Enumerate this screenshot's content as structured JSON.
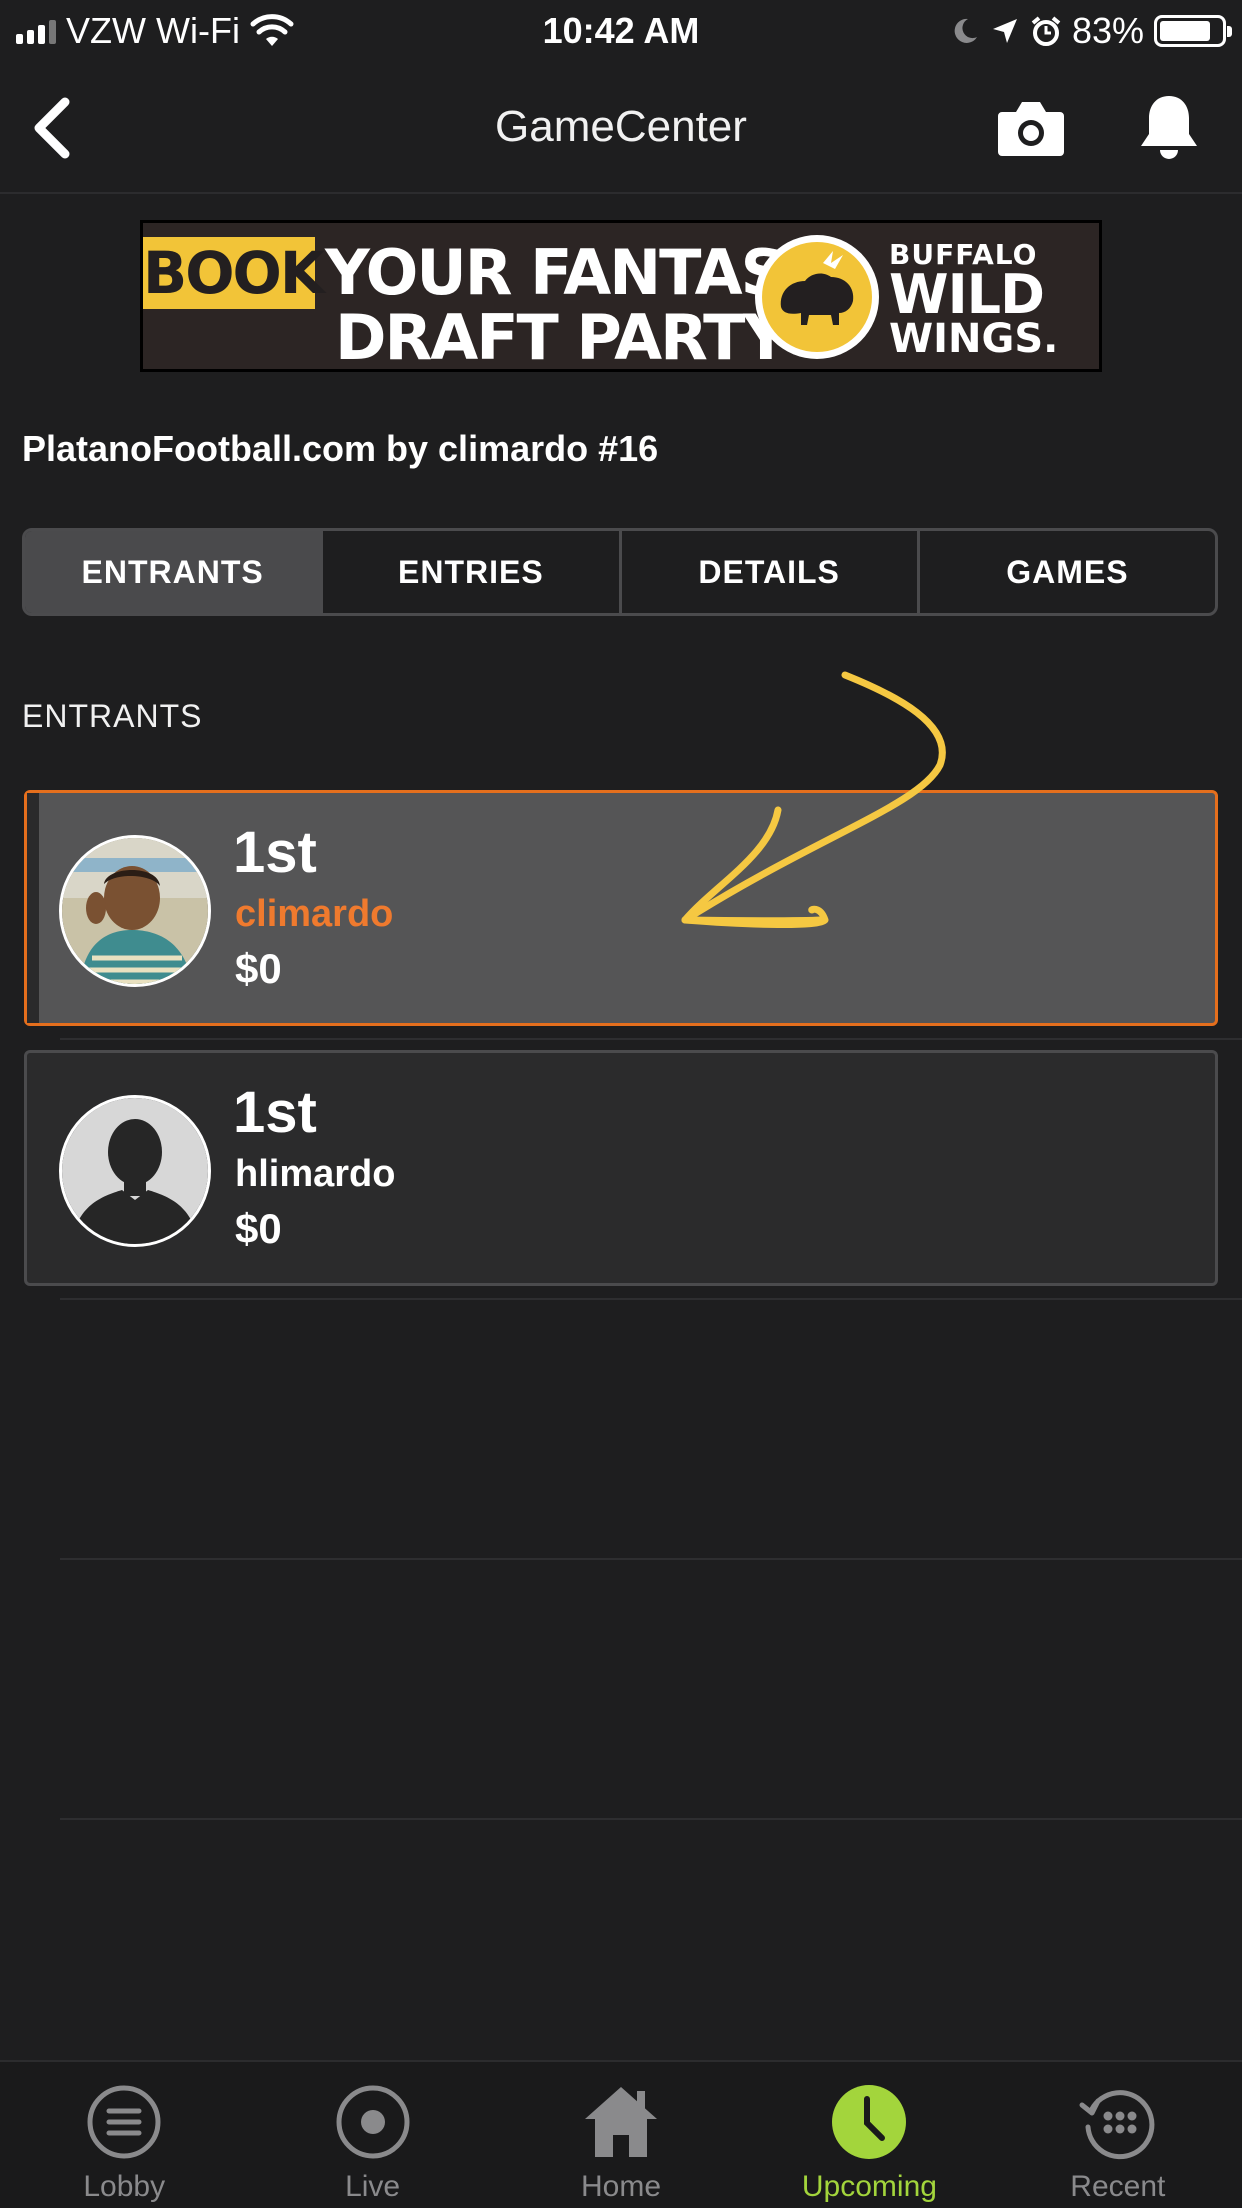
{
  "status_bar": {
    "carrier": "VZW Wi-Fi",
    "time": "10:42 AM",
    "battery": "83%",
    "battery_level": 0.83,
    "icons": [
      "signal-icon",
      "wifi-icon",
      "moon-icon",
      "location-arrow-icon",
      "alarm-icon",
      "battery-icon"
    ]
  },
  "nav": {
    "title": "GameCenter",
    "icons": [
      "back-chevron-icon",
      "camera-icon",
      "bell-icon"
    ]
  },
  "ad": {
    "book": "BOOK",
    "line1": "YOUR FANTASY",
    "line2": "DRAFT PARTY",
    "brand_line1": "BUFFALO",
    "brand_line2": "WILD",
    "brand_line3": "WINGS."
  },
  "league": {
    "title": "PlatanoFootball.com by climardo #16"
  },
  "tabs": [
    {
      "label": "ENTRANTS",
      "active": true
    },
    {
      "label": "ENTRIES",
      "active": false
    },
    {
      "label": "DETAILS",
      "active": false
    },
    {
      "label": "GAMES",
      "active": false
    }
  ],
  "section_header": "ENTRANTS",
  "entrants": [
    {
      "rank": "1st",
      "username": "climardo",
      "amount": "$0",
      "highlighted": true
    },
    {
      "rank": "1st",
      "username": "hlimardo",
      "amount": "$0",
      "highlighted": false
    }
  ],
  "colors": {
    "background": "#1e1e1f",
    "highlight_border": "#e56f1d",
    "highlight_name": "#ef7a2e",
    "active_tab": "#a3d53c",
    "annotation": "#f5c842"
  },
  "tab_bar": [
    {
      "label": "Lobby",
      "icon": "list-circle-icon",
      "current": false
    },
    {
      "label": "Live",
      "icon": "record-circle-icon",
      "current": false
    },
    {
      "label": "Home",
      "icon": "home-icon",
      "current": false
    },
    {
      "label": "Upcoming",
      "icon": "clock-icon",
      "current": true
    },
    {
      "label": "Recent",
      "icon": "history-dots-icon",
      "current": false
    }
  ]
}
